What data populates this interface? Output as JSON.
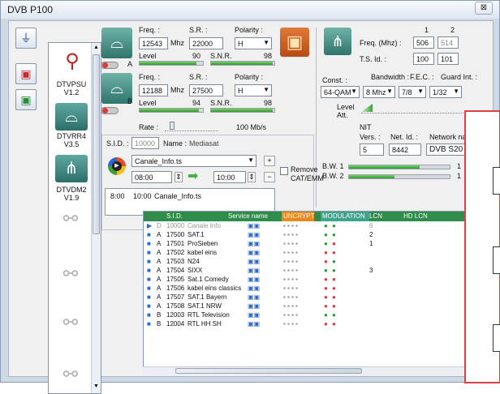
{
  "window": {
    "title": "DVB P100",
    "close_glyph": "⊠"
  },
  "toolbar": {
    "buttons": [
      {
        "icon": "plug-icon",
        "glyph": "⏚"
      },
      {
        "icon": "save-red-icon",
        "glyph": "💾"
      },
      {
        "icon": "save-green-icon",
        "glyph": "💾"
      }
    ]
  },
  "devices": [
    {
      "name": "DTVPSU",
      "version": "V1.2",
      "icon": "usb-icon"
    },
    {
      "name": "DTVRR4",
      "version": "V3.5",
      "icon": "dish-icon"
    },
    {
      "name": "DTVDM2",
      "version": "V1.9",
      "icon": "antenna-icon"
    }
  ],
  "sat": {
    "a": {
      "letter": "A",
      "freq_label": "Freq. :",
      "freq": "12543",
      "mhz": "Mhz",
      "sr_label": "S.R. :",
      "sr": "22000",
      "pol_label": "Polarity :",
      "pol": "H",
      "level_label": "Level",
      "level": "90",
      "snr_label": "S.N.R.",
      "snr": "98",
      "level_pct": 0.9,
      "snr_pct": 0.98
    },
    "b": {
      "letter": "B",
      "freq_label": "Freq. :",
      "freq": "12188",
      "mhz": "Mhz",
      "sr_label": "S.R. :",
      "sr": "27500",
      "pol_label": "Polarity :",
      "pol": "H",
      "level_label": "Level",
      "level": "94",
      "snr_label": "S.N.R.",
      "snr": "98",
      "level_pct": 0.94,
      "snr_pct": 0.98
    },
    "rate_label": "Rate :",
    "rate": "100 Mb/s"
  },
  "service": {
    "sid_label": "S.I.D. :",
    "sid": "10000",
    "name_label": "Name :",
    "name": "Mediasat",
    "file": "Canale_Info.ts",
    "start": "08:00",
    "end": "10:00",
    "remove_label": "Remove",
    "remove_label2": "CAT/EMM",
    "schedule": {
      "start": "8:00",
      "end": "10:00",
      "file": "Canale_Info.ts"
    }
  },
  "terr": {
    "col1": "1",
    "col2": "2",
    "freq_label": "Freq. (Mhz) :",
    "freq1": "506",
    "freq2": "514",
    "tsid_label": "T.S. Id. :",
    "tsid1": "100",
    "tsid2": "101",
    "const_label": "Const. :",
    "bw_label": "Bandwidth :",
    "fec_label": "F.E.C. :",
    "gi_label": "Guard Int. :",
    "const": "64-QAM",
    "bw": "8 Mhz",
    "fec": "7/8",
    "gi": "1/32",
    "level_label": "Level",
    "att_label": "Att.",
    "nit_label": "NIT",
    "vers_label": "Vers. :",
    "vers": "5",
    "netid_label": "Net. Id. :",
    "netid": "8442",
    "netname_label": "Network na",
    "netname": "DVB S20",
    "bw1_label": "B.W. 1",
    "bw2_label": "B.W. 2",
    "bw1_val": "1",
    "bw2_val": "1",
    "bw1_pct": 0.7,
    "bw2_pct": 0.45
  },
  "table": {
    "headers": [
      "S.I.D.",
      "Service name",
      "UNCRYPT",
      "MODULATION",
      "LCN",
      "HD LCN"
    ],
    "rows": [
      {
        "src": "D",
        "sid": "10000",
        "name": "Canale Info",
        "lcn": "6",
        "muted": true
      },
      {
        "src": "A",
        "sid": "17500",
        "name": "SAT.1",
        "lcn": "2",
        "muted": false
      },
      {
        "src": "A",
        "sid": "17501",
        "name": "ProSieben",
        "lcn": "1",
        "muted": false
      },
      {
        "src": "A",
        "sid": "17502",
        "name": "kabel eins",
        "lcn": "",
        "muted": false
      },
      {
        "src": "A",
        "sid": "17503",
        "name": "N24",
        "lcn": "",
        "muted": false
      },
      {
        "src": "A",
        "sid": "17504",
        "name": "SIXX",
        "lcn": "3",
        "muted": false
      },
      {
        "src": "A",
        "sid": "17505",
        "name": "Sat.1 Comedy",
        "lcn": "",
        "muted": false
      },
      {
        "src": "A",
        "sid": "17506",
        "name": "kabel eins classics",
        "lcn": "",
        "muted": false
      },
      {
        "src": "A",
        "sid": "17507",
        "name": "SAT.1 Bayern",
        "lcn": "",
        "muted": false
      },
      {
        "src": "A",
        "sid": "17508",
        "name": "SAT.1 NRW",
        "lcn": "",
        "muted": false
      },
      {
        "src": "B",
        "sid": "12003",
        "name": "RTL Television",
        "lcn": "",
        "muted": false
      },
      {
        "src": "B",
        "sid": "12004",
        "name": "RTL HH SH",
        "lcn": "",
        "muted": false
      }
    ]
  },
  "colors": {
    "header_green": "#2f8c4a",
    "uncrypt_orange": "#e8891e",
    "modulation_teal": "#3aa58a",
    "popup_red": "#e04040"
  }
}
